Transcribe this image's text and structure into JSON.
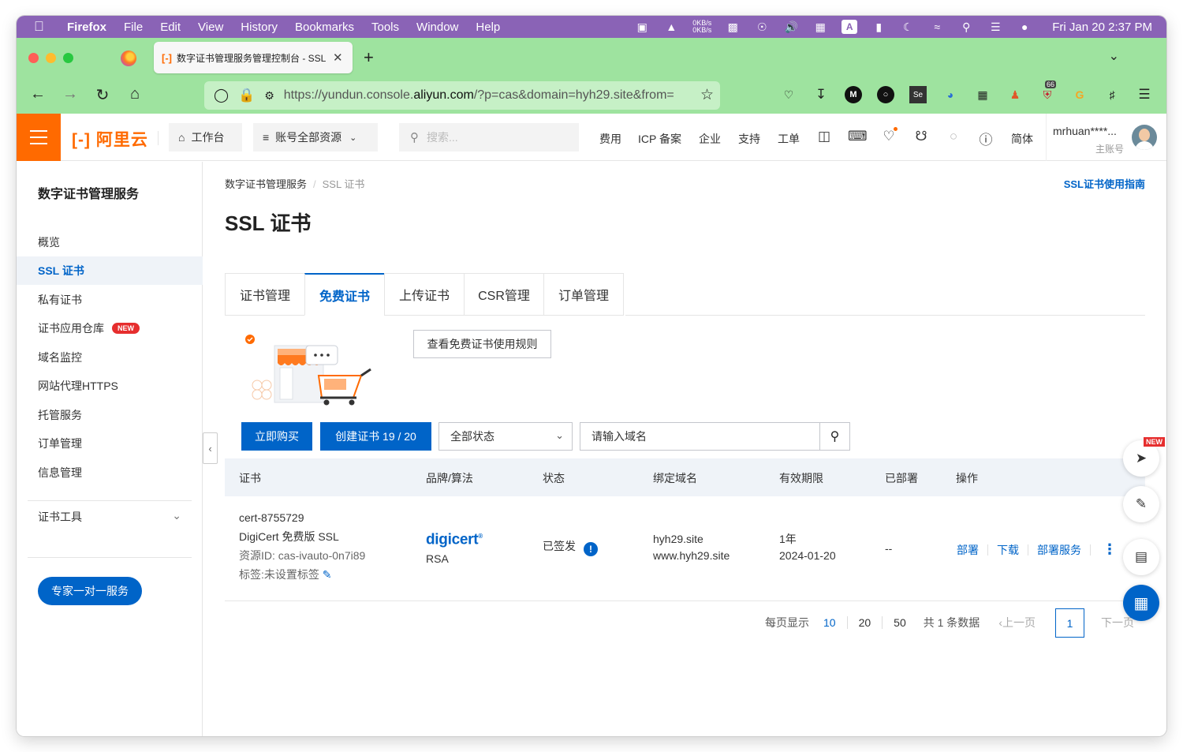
{
  "menubar": {
    "app": "Firefox",
    "items": [
      "File",
      "Edit",
      "View",
      "History",
      "Bookmarks",
      "Tools",
      "Window",
      "Help"
    ],
    "net_up": "0KB/s",
    "net_down": "0KB/s",
    "clock": "Fri Jan 20  2:37 PM"
  },
  "browser": {
    "tab_title": "数字证书管理服务管理控制台 - SSL",
    "url_prefix": "https://yundun.console.",
    "url_domain": "aliyun.com",
    "url_suffix": "/?p=cas&domain=hyh29.site&from=",
    "ext_badge": "66"
  },
  "header": {
    "logo": "阿里云",
    "workbench": "工作台",
    "resources": "账号全部资源",
    "search_placeholder": "搜索...",
    "links": [
      "费用",
      "ICP 备案",
      "企业",
      "支持",
      "工单"
    ],
    "lang": "简体",
    "user_name": "mrhuan****...",
    "user_role": "主账号"
  },
  "sidebar": {
    "title": "数字证书管理服务",
    "items": [
      {
        "label": "概览"
      },
      {
        "label": "SSL 证书"
      },
      {
        "label": "私有证书"
      },
      {
        "label": "证书应用仓库",
        "badge": "NEW"
      },
      {
        "label": "域名监控"
      },
      {
        "label": "网站代理HTTPS"
      },
      {
        "label": "托管服务"
      },
      {
        "label": "订单管理"
      },
      {
        "label": "信息管理"
      }
    ],
    "tools": "证书工具",
    "expert_button": "专家一对一服务"
  },
  "main": {
    "breadcrumb": [
      "数字证书管理服务",
      "SSL 证书"
    ],
    "guide_link": "SSL证书使用指南",
    "title": "SSL 证书",
    "tabs": [
      "证书管理",
      "免费证书",
      "上传证书",
      "CSR管理",
      "订单管理"
    ],
    "rules_button": "查看免费证书使用规则",
    "buy_button": "立即购买",
    "create_button": "创建证书 19 / 20",
    "status_select": "全部状态",
    "domain_placeholder": "请输入域名",
    "columns": [
      "证书",
      "品牌/算法",
      "状态",
      "绑定域名",
      "有效期限",
      "已部署",
      "操作"
    ],
    "row": {
      "cert_id": "cert-8755729",
      "cert_name": "DigiCert 免费版 SSL",
      "resource_id": "资源ID: cas-ivauto-0n7i89",
      "tags": "标签:未设置标签",
      "brand": "digicert",
      "algorithm": "RSA",
      "status": "已签发",
      "domain1": "hyh29.site",
      "domain2": "www.hyh29.site",
      "validity": "1年",
      "expiry": "2024-01-20",
      "deployed": "--",
      "actions": [
        "部署",
        "下载",
        "部署服务"
      ]
    },
    "pagination": {
      "per_page_label": "每页显示",
      "sizes": [
        "10",
        "20",
        "50"
      ],
      "total": "共 1 条数据",
      "prev": "上一页",
      "current": "1",
      "next": "下一页"
    },
    "float_badge": "NEW"
  },
  "colors": {
    "brand_orange": "#ff6a00",
    "primary_blue": "#0064c8",
    "menubar": "#8a63b6",
    "browser_chrome": "#9ee39f"
  }
}
